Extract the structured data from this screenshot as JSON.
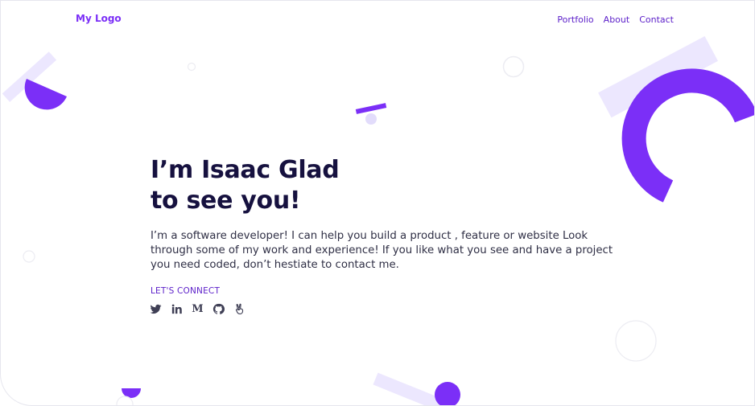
{
  "header": {
    "logo": "My Logo",
    "nav": [
      {
        "label": "Portfolio"
      },
      {
        "label": "About"
      },
      {
        "label": "Contact"
      }
    ]
  },
  "hero": {
    "title_line1": "I’m Isaac Glad",
    "title_line2": "to see you!",
    "intro": "I’m a software developer! I can help you build a product , feature or website Look through some of my work and experience! If you like what you see and have a project you need coded, don’t hestiate to contact me.",
    "connect_label": "LET'S CONNECT"
  },
  "socials": [
    {
      "icon": "twitter-icon"
    },
    {
      "icon": "linkedin-icon"
    },
    {
      "icon": "medium-icon"
    },
    {
      "icon": "github-icon"
    },
    {
      "icon": "angellist-icon"
    }
  ],
  "colors": {
    "accent": "#7b2ff7",
    "nav": "#5b1ec9",
    "heading": "#16113f",
    "soft_lavender": "#ece7fe",
    "icon": "#3f3f55"
  }
}
